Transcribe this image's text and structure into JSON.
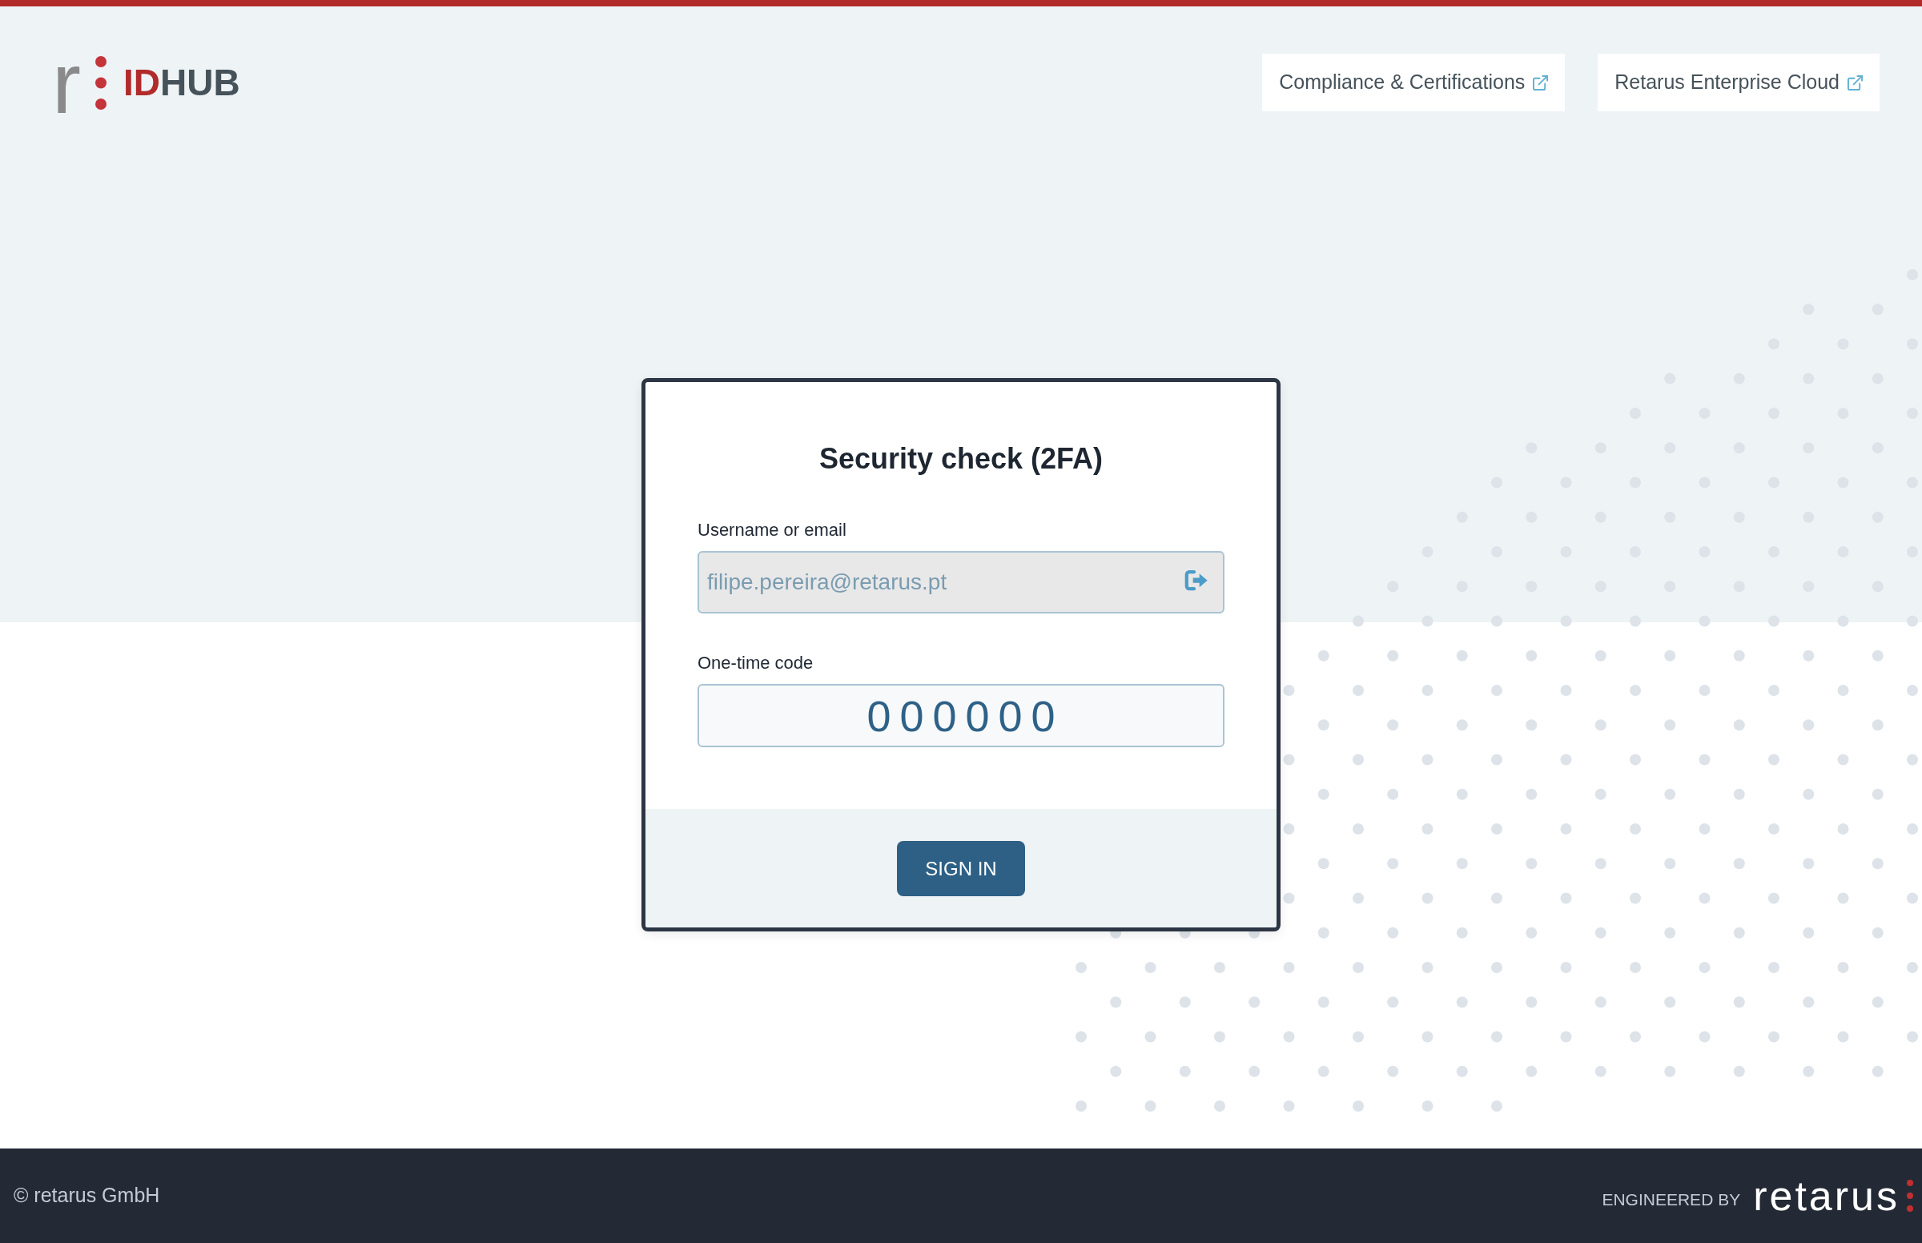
{
  "header": {
    "logo": {
      "letter": "r",
      "highlight": "ID",
      "rest": "HUB"
    },
    "links": [
      {
        "label": "Compliance & Certifications",
        "external": true
      },
      {
        "label": "Retarus Enterprise Cloud",
        "external": true
      }
    ]
  },
  "form": {
    "title": "Security check (2FA)",
    "fields": [
      {
        "kind": "username",
        "label": "Username or email",
        "value": "filipe.pereira@retarus.pt",
        "disabled": true
      },
      {
        "kind": "code",
        "label": "One-time code",
        "value": "000000",
        "disabled": false
      }
    ],
    "submit": "SIGN IN"
  },
  "footer": {
    "copyright": "© retarus GmbH",
    "engineered_by": "ENGINEERED BY",
    "brand": "retarus"
  }
}
